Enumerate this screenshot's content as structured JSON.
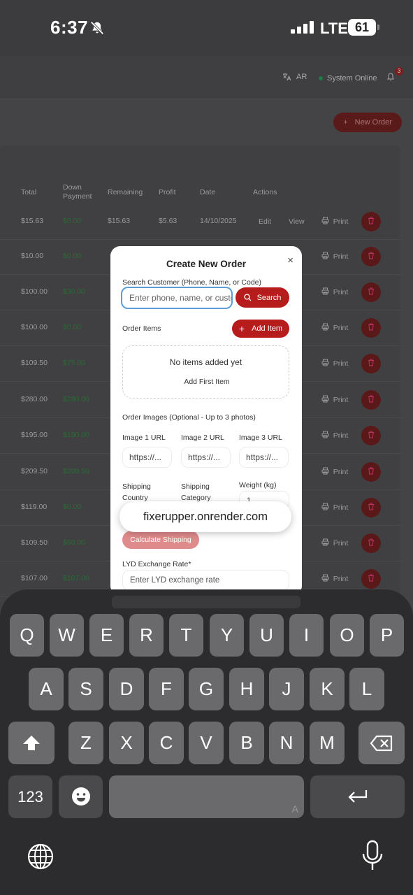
{
  "status_bar": {
    "time": "6:37",
    "network": "LTE",
    "battery": "61"
  },
  "header": {
    "language_label": "AR",
    "system_status": "System Online",
    "notification_count": "3",
    "new_order_label": "New Order"
  },
  "table": {
    "columns": [
      "Total",
      "Down Payment",
      "Remaining",
      "Profit",
      "Date",
      "Actions"
    ],
    "rows": [
      {
        "total": "$15.63",
        "down": "$0.00",
        "remaining": "$15.63",
        "profit": "$5.63",
        "date": "14/10/2025"
      },
      {
        "total": "$10.00",
        "down": "$0.00"
      },
      {
        "total": "$100.00",
        "down": "$30.00"
      },
      {
        "total": "$100.00",
        "down": "$0.00"
      },
      {
        "total": "$109.50",
        "down": "$75.00"
      },
      {
        "total": "$280.00",
        "down": "$280.00"
      },
      {
        "total": "$195.00",
        "down": "$150.00"
      },
      {
        "total": "$209.50",
        "down": "$209.50"
      },
      {
        "total": "$119.00",
        "down": "$0.00"
      },
      {
        "total": "$109.50",
        "down": "$50.00"
      },
      {
        "total": "$107.00",
        "down": "$107.00"
      }
    ],
    "edit_label": "Edit",
    "view_label": "View",
    "print_label": "Print"
  },
  "modal": {
    "title": "Create New Order",
    "close_icon": "×",
    "search_label": "Search Customer (Phone, Name, or Code)",
    "search_placeholder": "Enter phone, name, or customer code",
    "search_button": "Search",
    "order_items_label": "Order Items",
    "add_item_button": "Add Item",
    "empty_text": "No items added yet",
    "add_first_button": "Add First Item",
    "images_label": "Order Images (Optional - Up to 3 photos)",
    "image_labels": [
      "Image 1 URL",
      "Image 2 URL",
      "Image 3 URL"
    ],
    "image_placeholder": "https://...",
    "shipping_country_label": "Shipping Country",
    "shipping_category_label": "Shipping Category",
    "weight_label": "Weight (kg)",
    "weight_value": "1",
    "calc_button": "Calculate Shipping",
    "lyd_label": "LYD Exchange Rate*",
    "lyd_placeholder": "Enter LYD exchange rate"
  },
  "url_bar": {
    "url": "fixerupper.onrender.com"
  },
  "keyboard": {
    "row1": [
      "Q",
      "W",
      "E",
      "R",
      "T",
      "Y",
      "U",
      "I",
      "O",
      "P"
    ],
    "row2": [
      "A",
      "S",
      "D",
      "F",
      "G",
      "H",
      "J",
      "K",
      "L"
    ],
    "row3": [
      "Z",
      "X",
      "C",
      "V",
      "B",
      "N",
      "M"
    ],
    "numbers_key": "123",
    "space_hint": "A"
  }
}
